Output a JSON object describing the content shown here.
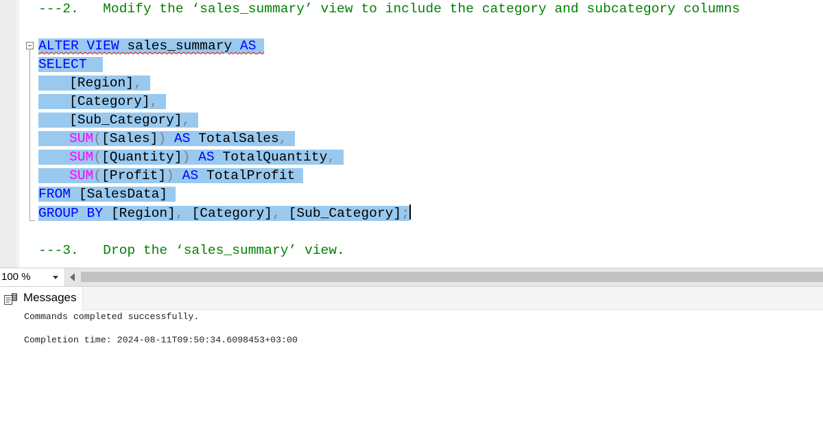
{
  "editor": {
    "comment_2": "---2.   Modify the ‘sales_summary’ view to include the category and subcategory columns",
    "alter_kw": "ALTER VIEW",
    "view_name": "sales_summary",
    "as_kw": "AS",
    "select_kw": "SELECT",
    "col_region": "[Region]",
    "col_category": "[Category]",
    "col_subcategory": "[Sub_Category]",
    "sum_fn": "SUM",
    "sales_arg": "[Sales]",
    "quantity_arg": "[Quantity]",
    "profit_arg": "[Profit]",
    "alias_sales": "TotalSales",
    "alias_quantity": "TotalQuantity",
    "alias_profit": "TotalProfit",
    "from_kw": "FROM",
    "table_name": "[SalesData]",
    "group_by_kw": "GROUP BY",
    "comma": ",",
    "open_paren": "(",
    "close_paren": ")",
    "semicolon": ";",
    "comment_3": "---3.   Drop the ‘sales_summary’ view."
  },
  "status": {
    "zoom_level": "100 %"
  },
  "results": {
    "tab_label": "Messages",
    "message_line": "Commands completed successfully.",
    "completion_line": "Completion time: 2024-08-11T09:50:34.6098453+03:00"
  },
  "colors": {
    "selection": "#99c9ef",
    "keyword": "#0000ff",
    "function": "#ff00ff",
    "comment": "#008000",
    "punctuation": "#808080"
  }
}
